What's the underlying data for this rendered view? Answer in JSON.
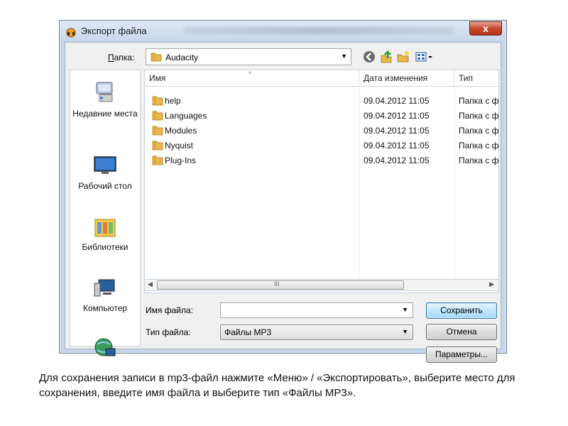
{
  "window": {
    "title": "Экспорт файла",
    "close_label": "x"
  },
  "folder_bar": {
    "label": "Папка:",
    "current": "Audacity",
    "toolbar_icons": [
      "back-icon",
      "up-folder-icon",
      "new-folder-icon",
      "view-menu-icon"
    ]
  },
  "places": [
    {
      "label": "Недавние места",
      "icon": "recent-places-icon"
    },
    {
      "label": "Рабочий стол",
      "icon": "desktop-icon"
    },
    {
      "label": "Библиотеки",
      "icon": "libraries-icon"
    },
    {
      "label": "Компьютер",
      "icon": "computer-icon"
    },
    {
      "label": "",
      "icon": "network-icon"
    }
  ],
  "file_list": {
    "columns": [
      "Имя",
      "Дата изменения",
      "Тип"
    ],
    "rows": [
      {
        "name": "help",
        "date": "09.04.2012 11:05",
        "type": "Папка с ф"
      },
      {
        "name": "Languages",
        "date": "09.04.2012 11:05",
        "type": "Папка с ф"
      },
      {
        "name": "Modules",
        "date": "09.04.2012 11:05",
        "type": "Папка с ф"
      },
      {
        "name": "Nyquist",
        "date": "09.04.2012 11:05",
        "type": "Папка с ф"
      },
      {
        "name": "Plug-Ins",
        "date": "09.04.2012 11:05",
        "type": "Папка с ф"
      }
    ],
    "scroll_grip": "III"
  },
  "form": {
    "filename_label": "Имя файла:",
    "filename_value": "",
    "filetype_label": "Тип файла:",
    "filetype_value": "Файлы MP3",
    "save_label": "Сохранить",
    "cancel_label": "Отмена",
    "options_label": "Параметры..."
  },
  "caption": "Для сохранения записи в mp3-файл нажмите «Меню» / «Экспортировать», выберите место для сохранения, введите имя файла и выберите тип «Файлы MP3».",
  "colors": {
    "accent": "#3c7fb1",
    "close_red": "#c74a30",
    "folder_yellow": "#e8b84a"
  }
}
